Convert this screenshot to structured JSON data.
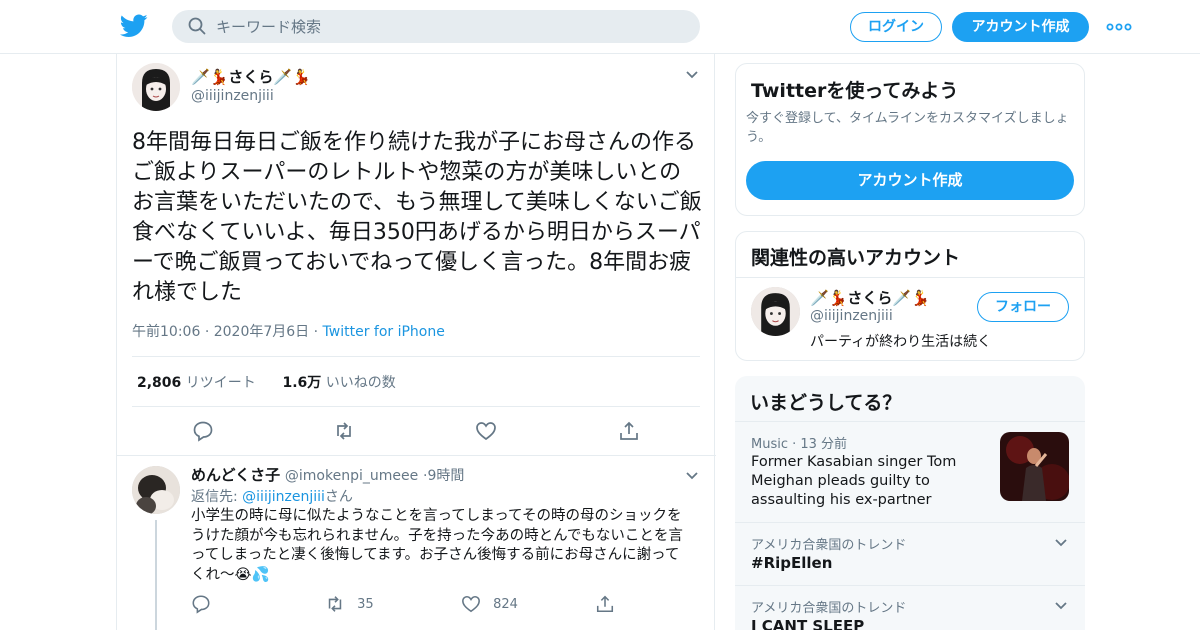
{
  "header": {
    "search_placeholder": "キーワード検索",
    "login_label": "ログイン",
    "signup_label": "アカウント作成"
  },
  "tweet": {
    "display_name": "🗡️💃さくら🗡️💃",
    "handle": "@iiijinzenjiii",
    "text": "8年間毎日毎日ご飯を作り続けた我が子にお母さんの作るご飯よりスーパーのレトルトや惣菜の方が美味しいとのお言葉をいただいたので、もう無理して美味しくないご飯食べなくていいよ、毎日350円あげるから明日からスーパーで晩ご飯買っておいでねって優しく言った。8年間お疲れ様でした",
    "time": "午前10:06",
    "date": "2020年7月6日",
    "source": "Twitter for iPhone",
    "retweets_count": "2,806",
    "retweets_label": "リツイート",
    "likes_count": "1.6万",
    "likes_label": "いいねの数"
  },
  "reply": {
    "display_name": "めんどくさ子",
    "handle": "@imokenpi_umeee",
    "time": "9時間",
    "reply_prefix": "返信先: ",
    "reply_to": "@iiijinzenjiii",
    "reply_suffix": "さん",
    "text": "小学生の時に母に似たようなことを言ってしまってその時の母のショックをうけた顔が今も忘れられません。子を持った今あの時とんでもないことを言ってしまったと凄く後悔してます。お子さん後悔する前にお母さんに謝ってくれ〜😭💦",
    "retweets": "35",
    "likes": "824"
  },
  "signup_card": {
    "title": "Twitterを使ってみよう",
    "subtitle": "今すぐ登録して、タイムラインをカスタマイズしましょう。",
    "button": "アカウント作成"
  },
  "related_card": {
    "title": "関連性の高いアカウント",
    "display_name": "🗡️💃さくら🗡️💃",
    "handle": "@iiijinzenjiii",
    "bio": "パーティが終わり生活は続く",
    "follow_label": "フォロー"
  },
  "trends": {
    "title": "いまどうしてる？",
    "items": [
      {
        "meta": "Music · 13 分前",
        "name": "Former Kasabian singer Tom Meighan pleads guilty to assaulting his ex-partner"
      },
      {
        "meta": "アメリカ合衆国のトレンド",
        "name": "#RipEllen"
      },
      {
        "meta": "アメリカ合衆国のトレンド",
        "name": "I CANT SLEEP"
      }
    ]
  },
  "colors": {
    "accent": "#1da1f2",
    "link": "#1b95e0",
    "muted": "#657786",
    "border": "#e6ecf0"
  }
}
